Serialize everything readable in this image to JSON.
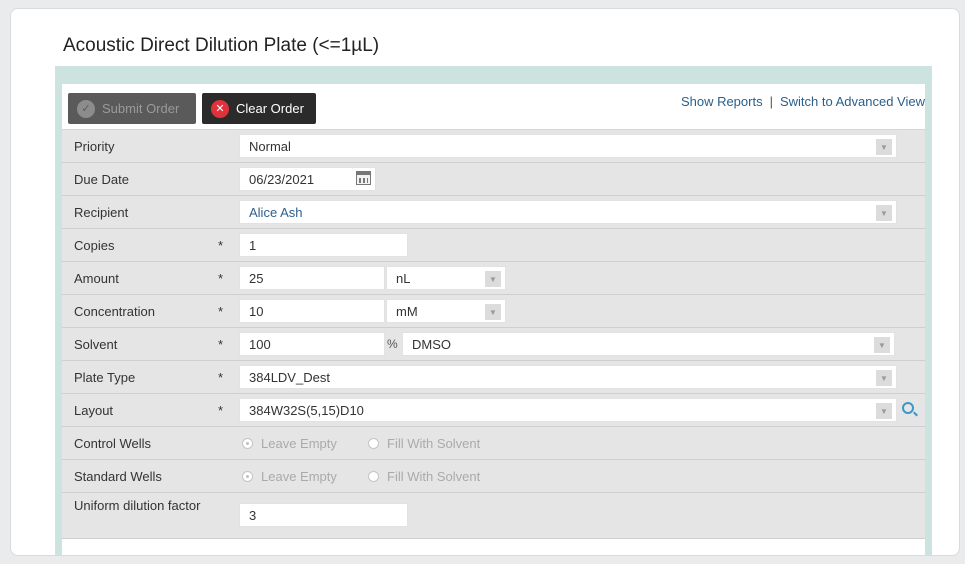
{
  "page": {
    "title": "Acoustic Direct Dilution Plate (<=1µL)"
  },
  "toolbar": {
    "submit_label": "Submit Order",
    "clear_label": "Clear Order",
    "show_reports": "Show Reports",
    "separator": "|",
    "advanced_view": "Switch to Advanced View"
  },
  "form": {
    "required_marker": "*",
    "priority": {
      "label": "Priority",
      "value": "Normal"
    },
    "due_date": {
      "label": "Due Date",
      "value": "06/23/2021"
    },
    "recipient": {
      "label": "Recipient",
      "value": "Alice Ash"
    },
    "copies": {
      "label": "Copies",
      "value": "1"
    },
    "amount": {
      "label": "Amount",
      "value": "25",
      "unit": "nL"
    },
    "concentration": {
      "label": "Concentration",
      "value": "10",
      "unit": "mM"
    },
    "solvent": {
      "label": "Solvent",
      "value": "100",
      "percent": "%",
      "solvent_name": "DMSO"
    },
    "plate_type": {
      "label": "Plate Type",
      "value": "384LDV_Dest"
    },
    "layout": {
      "label": "Layout",
      "value": "384W32S(5,15)D10"
    },
    "control_wells": {
      "label": "Control Wells",
      "option1": "Leave Empty",
      "option2": "Fill With Solvent",
      "selected": "Leave Empty"
    },
    "standard_wells": {
      "label": "Standard Wells",
      "option1": "Leave Empty",
      "option2": "Fill With Solvent",
      "selected": "Leave Empty"
    },
    "uniform_dilution": {
      "label": "Uniform dilution factor",
      "value": "3"
    }
  },
  "colors": {
    "panel": "#cde3e0",
    "link": "#2a5f8a",
    "clear_icon": "#e0323a",
    "search_icon": "#3a97c9"
  },
  "icons": [
    "check-icon",
    "clear-x-icon",
    "calendar-icon",
    "dropdown-arrow-icon",
    "search-icon"
  ]
}
